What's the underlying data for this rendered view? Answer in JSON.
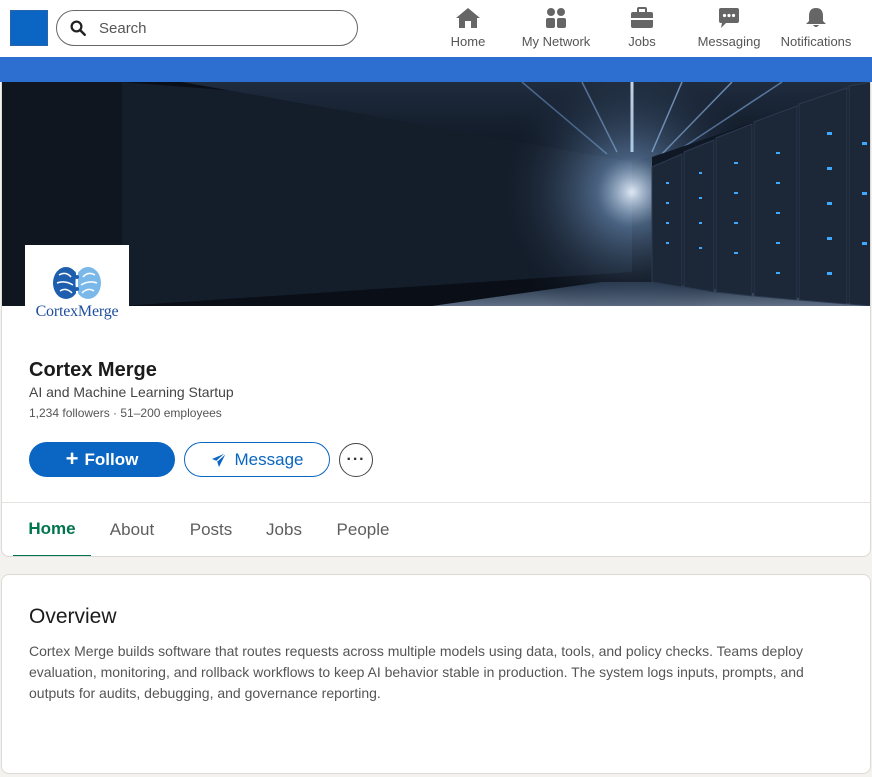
{
  "search": {
    "placeholder": "Search"
  },
  "nav": {
    "items": [
      {
        "label": "Home",
        "icon": "home-icon"
      },
      {
        "label": "My Network",
        "icon": "people-icon"
      },
      {
        "label": "Jobs",
        "icon": "briefcase-icon"
      },
      {
        "label": "Messaging",
        "icon": "chat-icon"
      },
      {
        "label": "Notifications",
        "icon": "bell-icon"
      }
    ]
  },
  "colors": {
    "brand_blue": "#0a66c2",
    "strip_blue": "#2d6fd0",
    "active_tab_green": "#01754f"
  },
  "company": {
    "logo_wordmark": "CortexMerge",
    "name": "Cortex Merge",
    "tagline": "AI and Machine Learning Startup",
    "meta": "1,234 followers · 51–200 employees"
  },
  "actions": {
    "follow_label": "Follow",
    "message_label": "Message",
    "more_label": "···"
  },
  "tabs": [
    {
      "label": "Home",
      "active": true
    },
    {
      "label": "About",
      "active": false
    },
    {
      "label": "Posts",
      "active": false
    },
    {
      "label": "Jobs",
      "active": false
    },
    {
      "label": "People",
      "active": false
    }
  ],
  "overview": {
    "title": "Overview",
    "body": "Cortex Merge builds software that routes requests across multiple models using data, tools, and policy checks. Teams deploy evaluation, monitoring, and rollback workflows to keep AI behavior stable in production. The system logs inputs, prompts, and outputs for audits, debugging, and governance reporting."
  }
}
